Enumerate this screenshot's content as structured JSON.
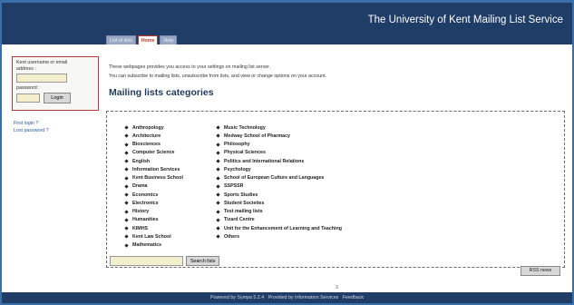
{
  "header": {
    "title": "The University of Kent Mailing List Service"
  },
  "tabs": [
    {
      "label": "List of lists"
    },
    {
      "label": "Home",
      "active": true
    },
    {
      "label": "Help"
    }
  ],
  "login": {
    "email_label_1": "Kent username or email",
    "email_label_2": "address :",
    "email_value": "",
    "password_label": "password :",
    "password_value": "",
    "button_label": "Login"
  },
  "side_links": {
    "first_login": "First login ?",
    "lost_password": "Lost password ?"
  },
  "intro": {
    "line1": "These webpages provides you access to your settings on mailing list server.",
    "line2": "You can subscribe to mailing lists, unsubscribe from lists, and view or change options on your account."
  },
  "page_title": "Mailing lists categories",
  "categories_left": [
    "Anthropology",
    "Architecture",
    "Biosciences",
    "Computer Science",
    "English",
    "Information Services",
    "Kent Business School",
    "Drama",
    "Economics",
    "Electronics",
    "History",
    "Humanities",
    "KIMHS",
    "Kent Law School",
    "Mathematics"
  ],
  "categories_right": [
    "Music Technology",
    "Medway School of Pharmacy",
    "Philosophy",
    "Physical Sciences",
    "Politics and International Relations",
    "Psychology",
    "School of European Culture and Languages",
    "SSPSSR",
    "Sports Studies",
    "Student Societies",
    "Test mailing lists",
    "Tizard Centre",
    "Unit for the Enhancement of Learning and Teaching",
    "Others"
  ],
  "search": {
    "value": "",
    "button_label": "Search lists"
  },
  "rss": {
    "label": "RSS news"
  },
  "page_number": "3",
  "footer": {
    "powered": "Powered by Sympa 5.2.4",
    "provided": "Provided by Information Services",
    "feedback": "Feedback"
  },
  "colors": {
    "header_bg": "#1f3d66",
    "frame": "#3a6fa8",
    "active_tab": "#c0392b",
    "input_bg": "#f3efcc"
  }
}
